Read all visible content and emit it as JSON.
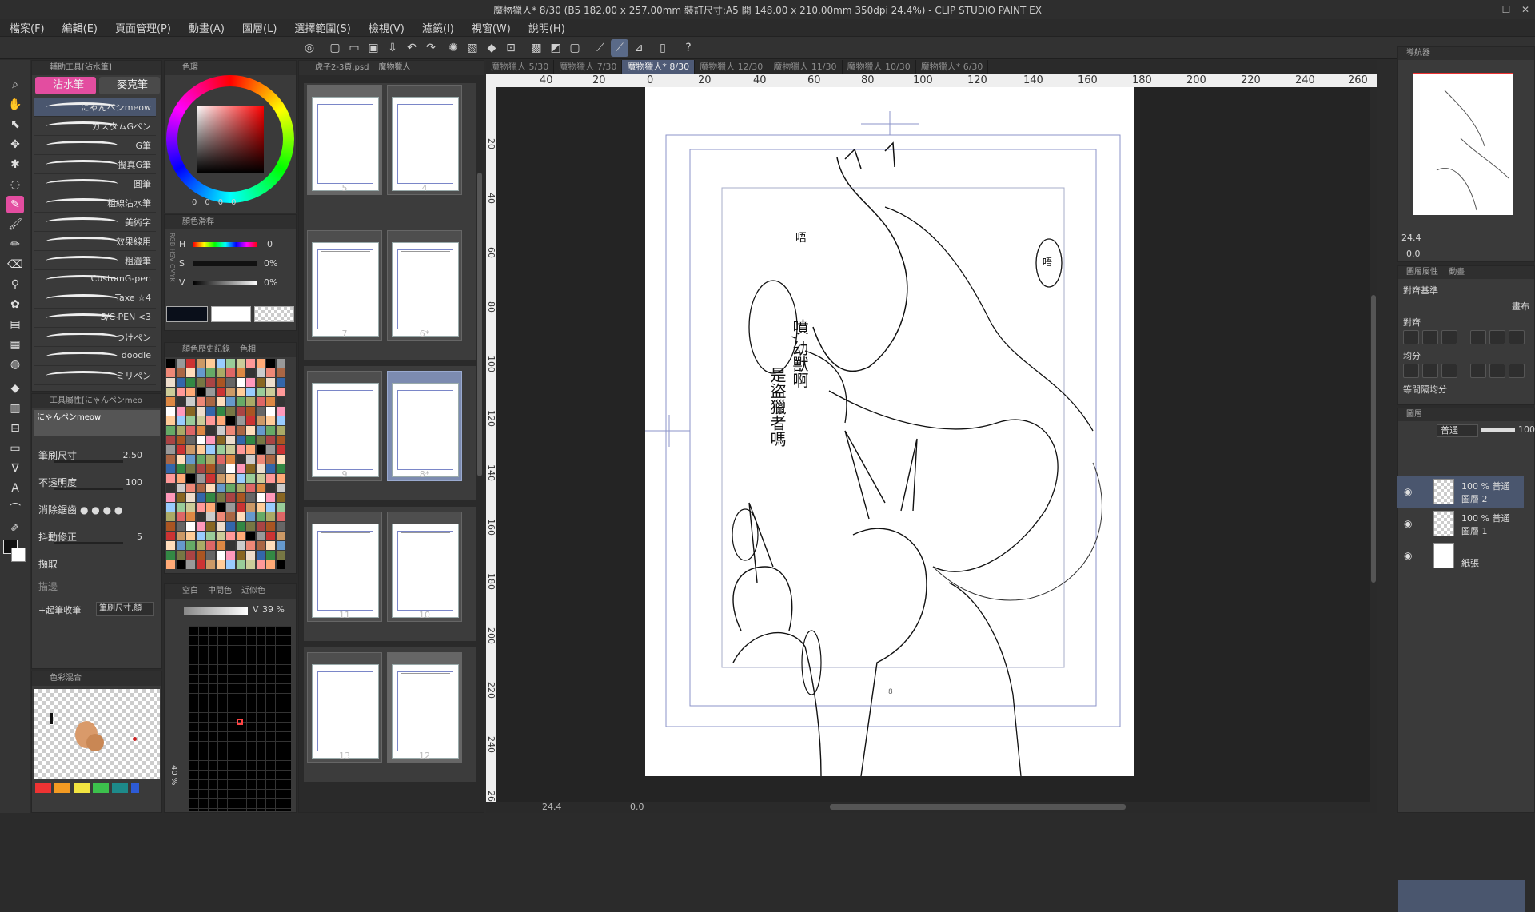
{
  "window": {
    "title": "魔物獵人* 8/30 (B5 182.00 x 257.00mm 裝訂尺寸:A5 開 148.00 x 210.00mm 350dpi 24.4%) - CLIP STUDIO PAINT EX",
    "min": "–",
    "max": "☐",
    "close": "✕"
  },
  "menu": [
    "檔案(F)",
    "編輯(E)",
    "頁面管理(P)",
    "動畫(A)",
    "圖層(L)",
    "選擇範圍(S)",
    "檢視(V)",
    "濾鏡(I)",
    "視窗(W)",
    "說明(H)"
  ],
  "subtool": {
    "panel_title": "輔助工具[沾水筆]",
    "tabs": [
      "沾水筆",
      "麥克筆"
    ],
    "brushes": [
      "にゃんペンmeow",
      "カスタムGペン",
      "G筆",
      "擬真G筆",
      "圓筆",
      "粗線沾水筆",
      "美術字",
      "效果線用",
      "粗澀筆",
      "CustomG-pen",
      "Taxe ☆4",
      "S/C PEN <3",
      "つけペン",
      "doodle",
      "ミリペン"
    ]
  },
  "toolprop": {
    "panel_title": "工具屬性[にゃんペンmeo",
    "brush_name": "にゃんペンmeow",
    "rows": [
      {
        "label": "筆刷尺寸",
        "value": "2.50"
      },
      {
        "label": "不透明度",
        "value": "100"
      },
      {
        "label": "消除鋸齒",
        "value": ""
      },
      {
        "label": "抖動修正",
        "value": "5"
      },
      {
        "label": "擷取",
        "value": ""
      },
      {
        "label": "描邊",
        "value": ""
      }
    ],
    "pressure": "+起筆收筆",
    "pressure_value": "筆刷尺寸,顏"
  },
  "colormix": {
    "panel_title": "色彩混合"
  },
  "colorwheel": {
    "panel_title": "色環",
    "readout": [
      "0",
      "0",
      "0",
      "0"
    ]
  },
  "colorslider": {
    "panel_title": "顏色滑桿",
    "modes": [
      "RGB",
      "HSV",
      "CMYK"
    ],
    "rows": [
      {
        "label": "H",
        "value": "0"
      },
      {
        "label": "S",
        "value": "0%"
      },
      {
        "label": "V",
        "value": "0%"
      }
    ]
  },
  "colorhistory": {
    "tabs": [
      "顏色歷史記錄",
      "色相"
    ]
  },
  "approx": {
    "tabs": [
      "空白",
      "中間色",
      "近似色"
    ],
    "v_label": "V",
    "v_value": "39 %",
    "side_label": "40 %"
  },
  "pages": {
    "tabs": [
      "虎子2-3頁.psd",
      "魔物獵人"
    ],
    "items": [
      "5",
      "4",
      "7",
      "6*",
      "9",
      "8*",
      "11",
      "10",
      "13",
      "12"
    ]
  },
  "doctabs": [
    "魔物獵人 5/30",
    "魔物獵人 7/30",
    "魔物獵人* 8/30",
    "魔物獵人 12/30",
    "魔物獵人 11/30",
    "魔物獵人 10/30",
    "魔物獵人* 6/30"
  ],
  "ruler": [
    "40",
    "20",
    "0",
    "20",
    "40",
    "60",
    "80",
    "100",
    "120",
    "140",
    "160",
    "180",
    "200",
    "220",
    "240",
    "260"
  ],
  "ruler_v": [
    "20",
    "40",
    "60",
    "80",
    "100",
    "120",
    "140",
    "160",
    "180",
    "200",
    "220",
    "240",
    "260"
  ],
  "status": {
    "zoom": "24.4",
    "angle": "0.0"
  },
  "canvas_text": {
    "bubble": "噴,幼獸啊",
    "bubble2": "是盜獵者嗎",
    "page_number": "8",
    "bubble_small": "唔",
    "bubble_small2": "唔"
  },
  "navigator": {
    "panel_title": "導航器",
    "zoom": "24.4",
    "angle": "0.0"
  },
  "layerprop": {
    "panel_title": "圖層屬性",
    "tab2": "動畫",
    "label_align": "對齊基準",
    "label_align2": "畫布",
    "label_distribute": "對齊",
    "label_even": "均分",
    "label_spacing": "等間隔均分"
  },
  "layers": {
    "panel_title": "圖層",
    "blend": "普通",
    "opacity": "100",
    "items": [
      {
        "line1": "100 % 普通",
        "line2": "圖層 2"
      },
      {
        "line1": "100 % 普通",
        "line2": "圖層 1"
      },
      {
        "line1": "",
        "line2": "紙張"
      }
    ]
  },
  "colors": {
    "accent": "#e34da0",
    "selection": "#4a566e",
    "pagesel": "#7c8bb0"
  }
}
